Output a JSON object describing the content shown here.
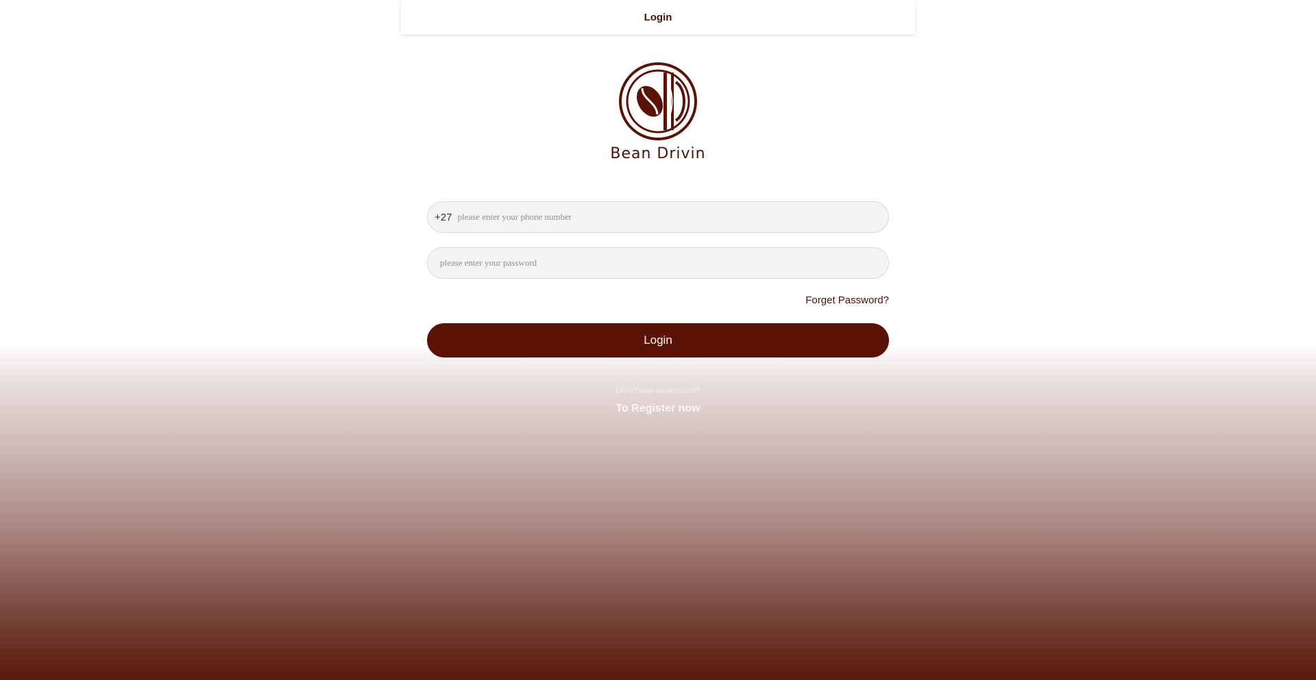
{
  "header": {
    "title": "Login"
  },
  "brand": {
    "name": "Bean Drivin",
    "logo_icon": "bean-drivin-logo-icon",
    "color": "#4a1106"
  },
  "form": {
    "phone": {
      "prefix": "+27",
      "value": "",
      "placeholder": "please enter your phone number"
    },
    "password": {
      "value": "",
      "placeholder": "please enter your password"
    },
    "forgot_label": "Forget Password?",
    "login_label": "Login"
  },
  "footer": {
    "no_account_text": "Dont have an account?",
    "register_label": "To Register now"
  },
  "colors": {
    "accent": "#5a1304",
    "field_bg": "#f3f4f6"
  }
}
